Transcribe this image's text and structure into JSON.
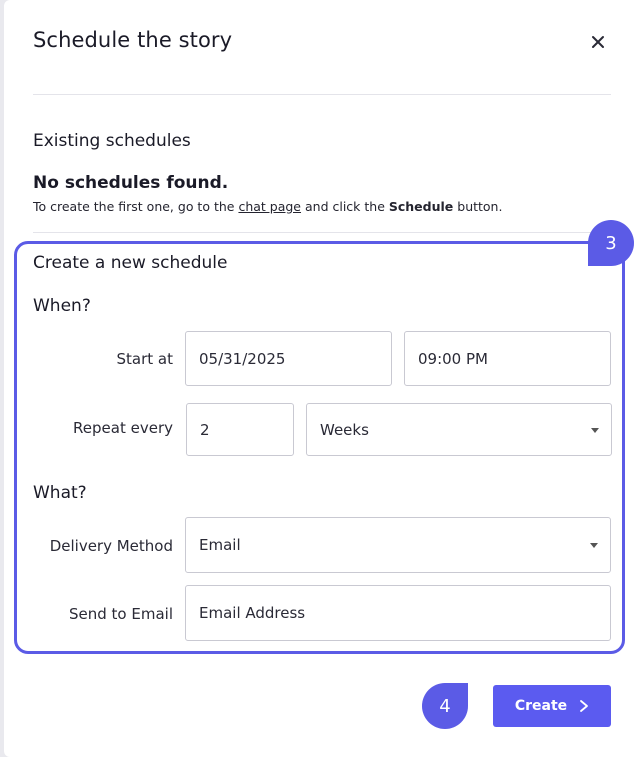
{
  "dialog": {
    "title": "Schedule the story",
    "close_icon": "close-icon"
  },
  "existing": {
    "heading": "Existing schedules",
    "empty_title": "No schedules found.",
    "desc_prefix": "To create the first one, go to the ",
    "desc_link": "chat page",
    "desc_middle": " and click the ",
    "desc_bold": "Schedule",
    "desc_suffix": " button."
  },
  "create_section": {
    "heading": "Create a new schedule",
    "when_heading": "When?",
    "start_at_label": "Start at",
    "start_date": "05/31/2025",
    "start_time": "09:00 PM",
    "repeat_label": "Repeat every",
    "repeat_value": "2",
    "repeat_unit": "Weeks",
    "what_heading": "What?",
    "delivery_label": "Delivery Method",
    "delivery_value": "Email",
    "send_to_label": "Send to Email",
    "send_to_placeholder": "Email Address"
  },
  "annotations": {
    "step3": "3",
    "step4": "4",
    "highlight_color": "#5b5be6"
  },
  "footer": {
    "create_label": "Create",
    "create_icon": "chevron-right-icon",
    "accent": "#5b5bf0"
  }
}
